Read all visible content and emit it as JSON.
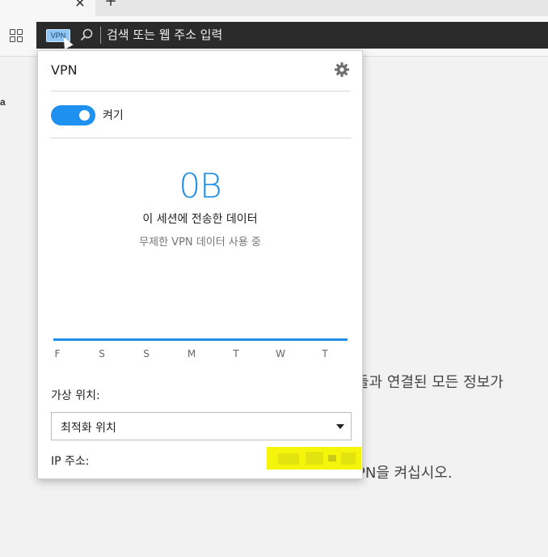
{
  "tab": {
    "close_glyph": "✕",
    "new_tab_glyph": "+"
  },
  "toolbar": {
    "tabs_icon": "tab-grid-icon",
    "vpn_badge": "VPN",
    "search_icon": "magnifier-icon",
    "address_placeholder": "검색 또는 웹 주소 입력"
  },
  "background": {
    "fragment_a": "a",
    "line1": "들과 연결된 모든 정보가",
    "line2": "PN을 켜십시오."
  },
  "vpn_panel": {
    "title": "VPN",
    "settings_icon": "gear-icon",
    "toggle_state": "on",
    "toggle_label": "켜기",
    "data_amount": "0B",
    "data_caption": "이 세션에 전송한 데이터",
    "data_subcaption": "무제한 VPN 데이터 사용 중",
    "days": [
      "F",
      "S",
      "S",
      "M",
      "T",
      "W",
      "T"
    ],
    "location_label": "가상 위치:",
    "location_value": "최적화 위치",
    "ip_label": "IP 주소:",
    "accent_color": "#1e8fe8",
    "redaction_color": "#f5f50b"
  }
}
